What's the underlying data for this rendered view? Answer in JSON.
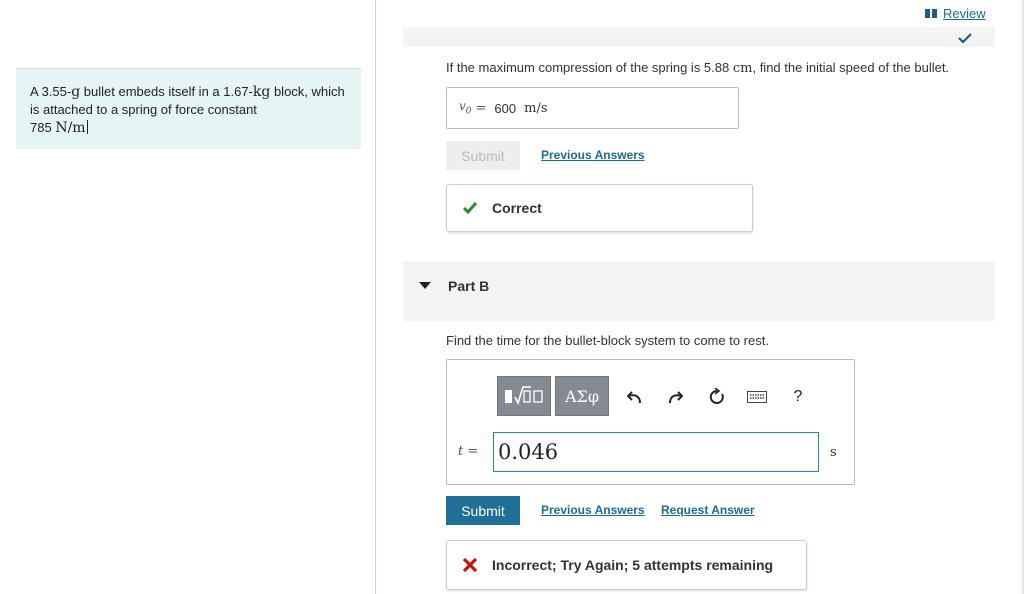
{
  "problem": {
    "text_1": "A 3.55-",
    "unit_g": "g",
    "text_2": " bullet embeds itself in a 1.67-",
    "unit_kg": "kg",
    "text_3": " block, which is attached to a spring of force constant",
    "text_4": "785 ",
    "unit_nm": "N/m"
  },
  "review": {
    "label": "Review"
  },
  "part_a": {
    "question_1": "If the maximum compression of the spring is 5.88 ",
    "question_unit": "cm",
    "question_2": ", find the initial speed of the bullet.",
    "answer_var": "v",
    "answer_sub": "0",
    "answer_eq": "=",
    "answer_value": "600",
    "answer_unit": "m/s",
    "submit_label": "Submit",
    "previous_answers_label": "Previous Answers",
    "feedback_text": "Correct"
  },
  "part_b": {
    "title": "Part B",
    "question": "Find the time for the bullet-block system to come to rest.",
    "toolbar": {
      "templates_icon": "templates-icon",
      "greek_label": "ΑΣφ",
      "help_label": "?"
    },
    "answer_var": "t",
    "answer_eq": "=",
    "answer_value": "0.046",
    "answer_unit": "s",
    "submit_label": "Submit",
    "previous_answers_label": "Previous Answers",
    "request_answer_label": "Request Answer",
    "feedback_text": "Incorrect; Try Again; 5 attempts remaining"
  },
  "colors": {
    "accent": "#1f6f96",
    "correct": "#2e8b2e",
    "incorrect": "#cc1111",
    "problem_bg": "#e6f4f5"
  }
}
